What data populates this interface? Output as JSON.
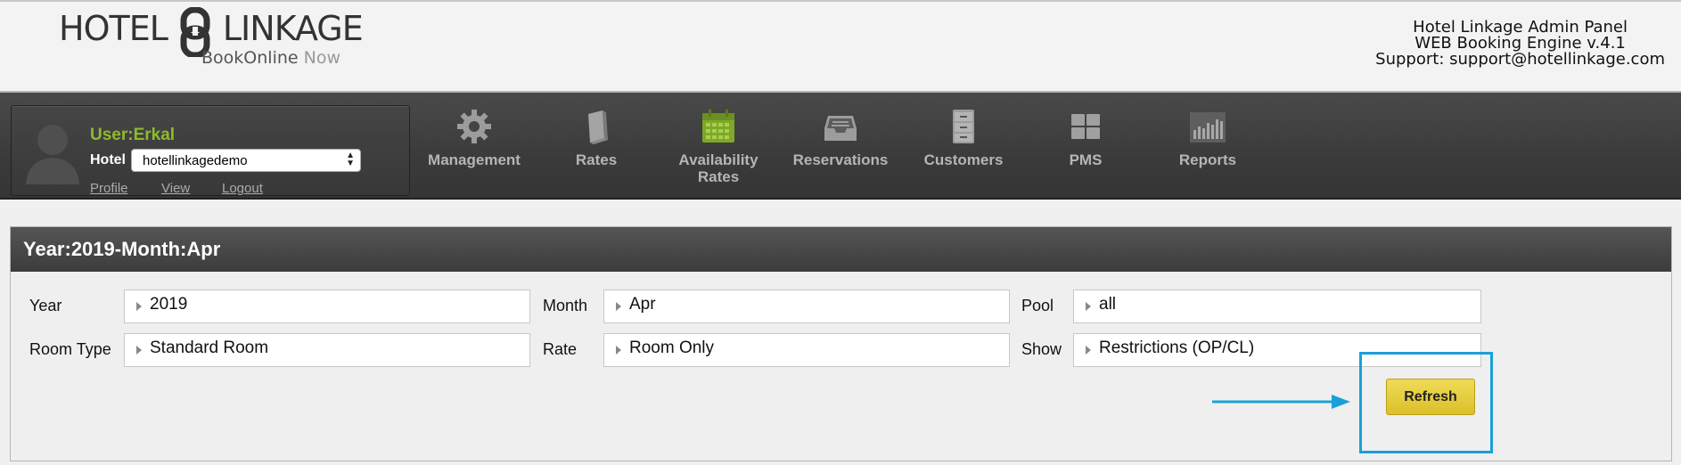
{
  "brand": {
    "logo_left": "HOTEL",
    "logo_right": "LINKAGE",
    "logo_sub": "BookOnline",
    "logo_sub_now": "Now"
  },
  "panel_info": {
    "line1": "Hotel Linkage Admin Panel",
    "line2": "WEB Booking Engine v.4.1",
    "line3": "Support: support@hotellinkage.com"
  },
  "user": {
    "name": "User:Erkal",
    "hotel_label": "Hotel",
    "hotel_value": "hotellinkagedemo",
    "links": [
      "Profile",
      "View",
      "Logout"
    ]
  },
  "nav": [
    {
      "label": "Management",
      "icon": "gear-icon"
    },
    {
      "label": "Rates",
      "icon": "book-icon"
    },
    {
      "label": "Availability\nRates",
      "icon": "calendar-icon"
    },
    {
      "label": "Reservations",
      "icon": "inbox-icon"
    },
    {
      "label": "Customers",
      "icon": "cabinet-icon"
    },
    {
      "label": "PMS",
      "icon": "grid-icon"
    },
    {
      "label": "Reports",
      "icon": "bar-chart-icon"
    }
  ],
  "colors": {
    "accent_green": "#8dbb2b",
    "refresh_yellow": "#e6cd3a",
    "highlight_blue": "#1aa0d8"
  },
  "main": {
    "title": "Year:2019-Month:Apr",
    "fields": {
      "year_label": "Year",
      "year_value": "2019",
      "month_label": "Month",
      "month_value": "Apr",
      "pool_label": "Pool",
      "pool_value": "all",
      "room_type_label": "Room Type",
      "room_type_value": "Standard Room",
      "rate_label": "Rate",
      "rate_value": "Room Only",
      "show_label": "Show",
      "show_value": "Restrictions (OP/CL)"
    },
    "refresh_label": "Refresh"
  }
}
